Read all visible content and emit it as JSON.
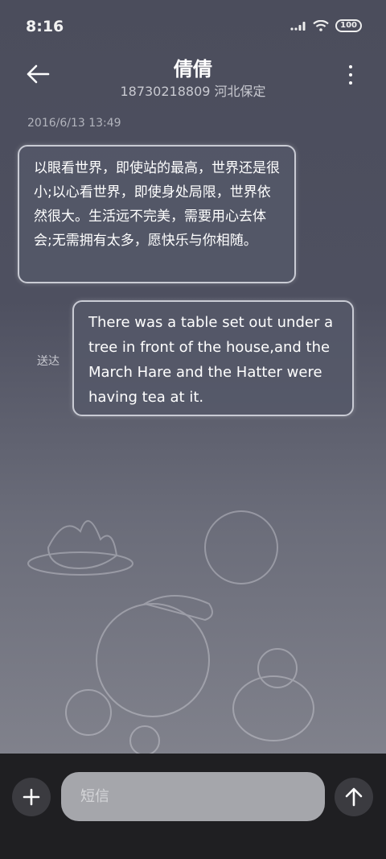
{
  "status_bar": {
    "time": "8:16",
    "battery": "100"
  },
  "header": {
    "contact_name": "倩倩",
    "contact_info": "18730218809 河北保定"
  },
  "conversation": {
    "timestamp": "2016/6/13 13:49",
    "messages": [
      {
        "direction": "incoming",
        "text": "以眼看世界，即使站的最高，世界还是很小;以心看世界，即使身处局限，世界依然很大。生活远不完美，需要用心去体会;无需拥有太多，愿快乐与你相随。"
      },
      {
        "direction": "outgoing",
        "text": "There was a table set out under a tree in front of the house,and the March Hare and the Hatter were having tea at it.",
        "status": "送达"
      }
    ]
  },
  "composer": {
    "placeholder": "短信"
  },
  "icons": {
    "back": "arrow-left-icon",
    "more": "more-vertical-icon",
    "add": "plus-icon",
    "send": "arrow-up-icon",
    "signal": "signal-icon",
    "wifi": "wifi-icon",
    "battery": "battery-icon"
  }
}
